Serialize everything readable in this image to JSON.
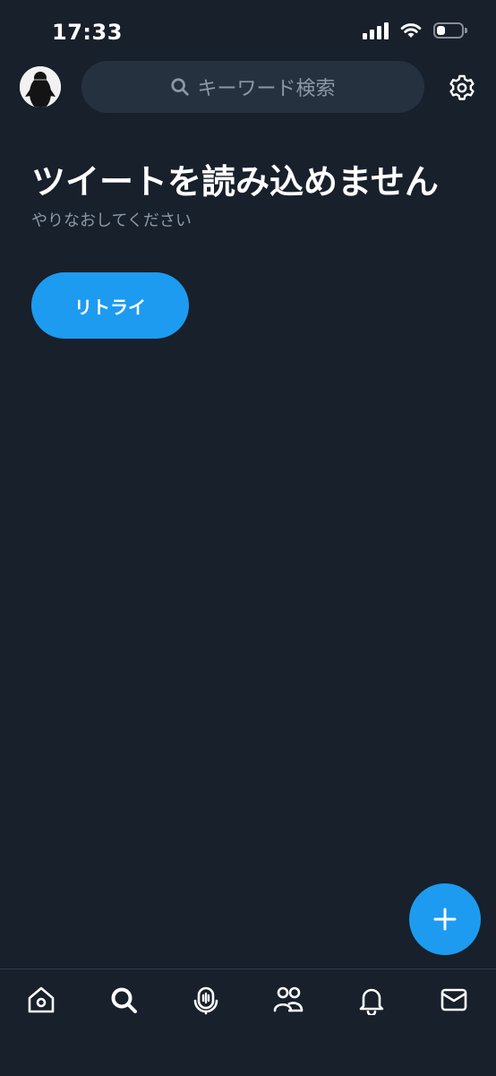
{
  "status_bar": {
    "time": "17:33",
    "icons": [
      "signal-icon",
      "wifi-icon",
      "battery-icon"
    ],
    "battery_level": 0.35
  },
  "header": {
    "avatar": "profile-avatar",
    "search": {
      "placeholder": "キーワード検索",
      "icon": "search-icon"
    },
    "settings_icon": "gear-icon"
  },
  "main": {
    "error_title": "ツイートを読み込めません",
    "error_subtitle": "やりなおしてください",
    "retry_label": "リトライ"
  },
  "fab": {
    "icon": "plus-icon"
  },
  "bottom_nav": {
    "items": [
      {
        "name": "home",
        "icon": "home-icon",
        "active": false
      },
      {
        "name": "search",
        "icon": "search-icon",
        "active": true
      },
      {
        "name": "spaces",
        "icon": "microphone-icon",
        "active": false
      },
      {
        "name": "communities",
        "icon": "people-icon",
        "active": false
      },
      {
        "name": "notifications",
        "icon": "bell-icon",
        "active": false
      },
      {
        "name": "messages",
        "icon": "mail-icon",
        "active": false
      }
    ]
  },
  "colors": {
    "background": "#17202b",
    "accent": "#1d9bf0",
    "search_bg": "#263140",
    "muted_text": "#8b98a5",
    "divider": "#2f3b48"
  }
}
